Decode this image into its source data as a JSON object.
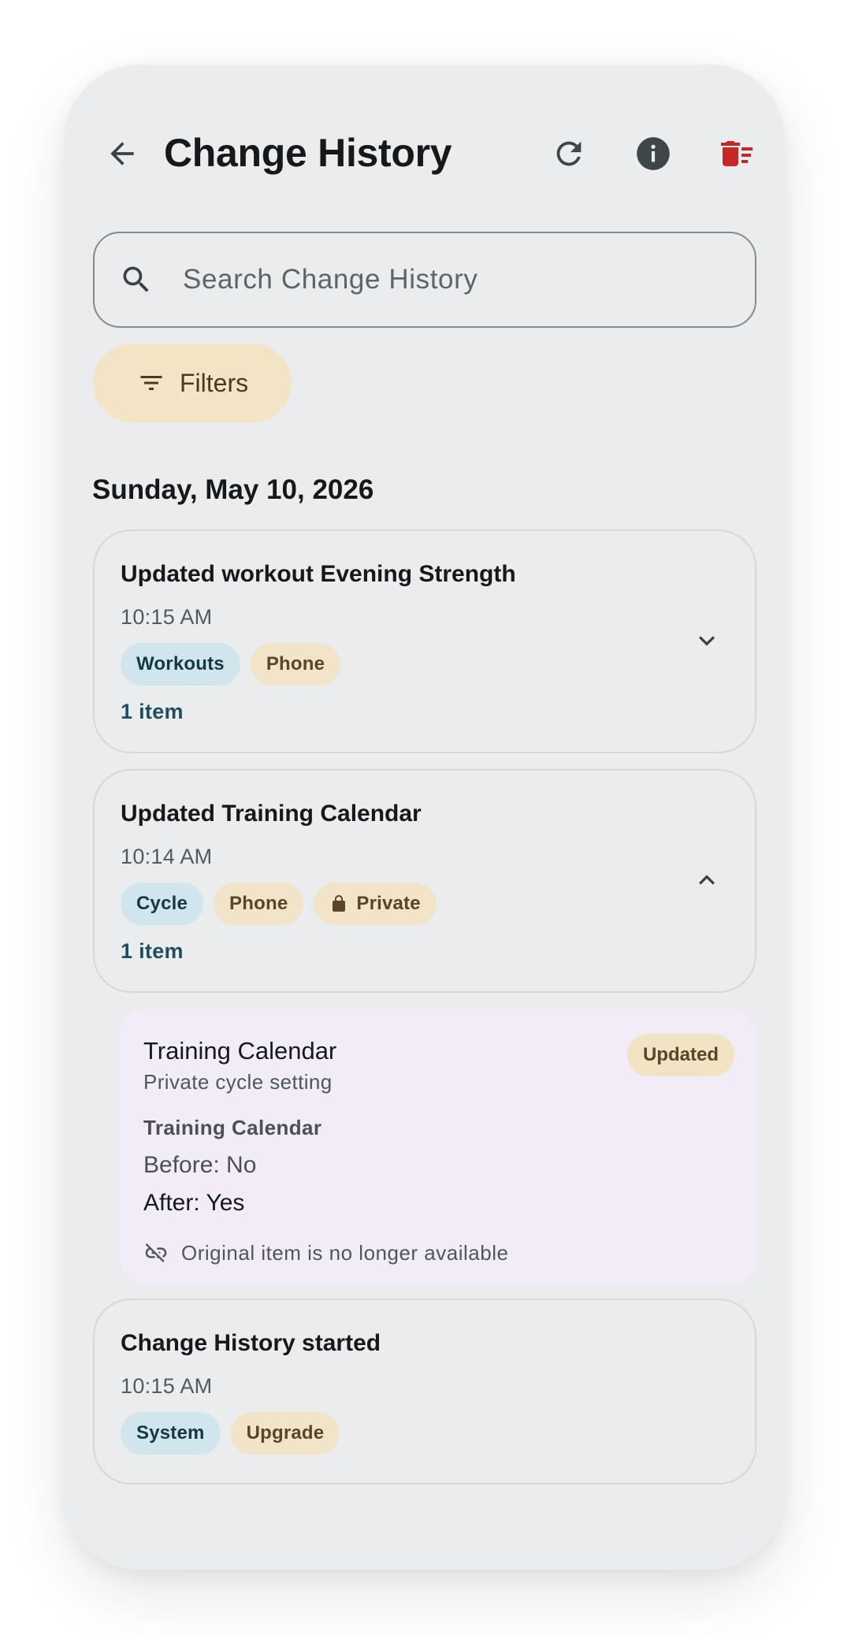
{
  "header": {
    "title": "Change History",
    "back_icon": "arrow-back-icon",
    "refresh_icon": "refresh-icon",
    "info_icon": "info-icon",
    "delete_icon": "delete-sweep-icon",
    "delete_color": "#c62828"
  },
  "search": {
    "placeholder": "Search Change History",
    "value": ""
  },
  "filters": {
    "label": "Filters"
  },
  "date_group": "Sunday, May 10, 2026",
  "entries": [
    {
      "title": "Updated workout Evening Strength",
      "time": "10:15 AM",
      "chips": [
        "Workouts",
        "Phone"
      ],
      "count": "1 item",
      "expanded": false
    },
    {
      "title": "Updated Training Calendar",
      "time": "10:14 AM",
      "chips": [
        "Cycle",
        "Phone",
        "Private"
      ],
      "count": "1 item",
      "expanded": true,
      "detail": {
        "title": "Training Calendar",
        "subtitle": "Private cycle setting",
        "badge": "Updated",
        "field": "Training Calendar",
        "before": "Before: No",
        "after": "After: Yes",
        "note": "Original item is no longer available"
      }
    },
    {
      "title": "Change History started",
      "time": "10:15 AM",
      "chips": [
        "System",
        "Upgrade"
      ]
    }
  ],
  "colors": {
    "surface": "#eaecee",
    "chip_blue": "#d1e6ec",
    "chip_sand": "#f1e4c8",
    "detail_bg": "#f1ecf7",
    "filters_bg": "#f3e4c6"
  }
}
